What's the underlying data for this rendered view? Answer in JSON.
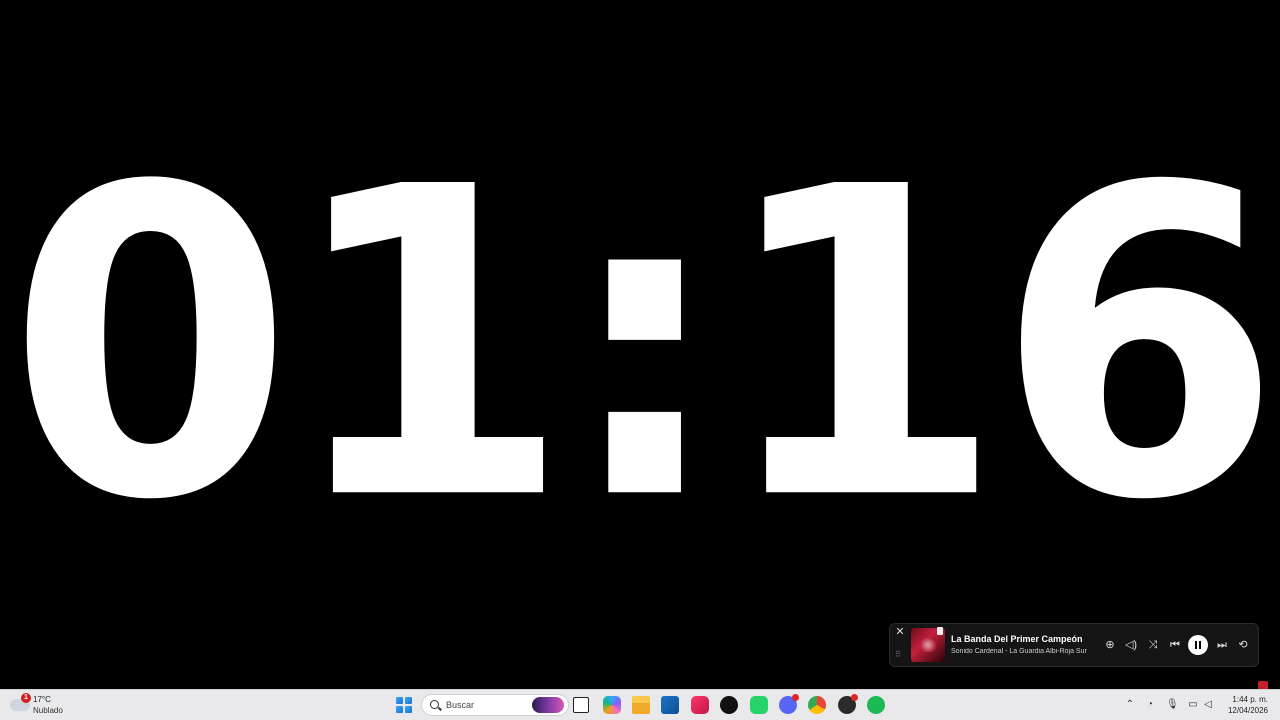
{
  "timer": {
    "display": "01:16"
  },
  "media": {
    "title": "La Banda Del Primer Campeón",
    "artist": "Sonido Cardenal - La Guardia Albi-Roja Sur"
  },
  "taskbar": {
    "weather": {
      "alert_count": "1",
      "temperature": "17°C",
      "condition": "Nublado"
    },
    "search": {
      "placeholder": "Buscar"
    },
    "pinned_icons": [
      "task-view-icon",
      "copilot-icon",
      "file-explorer-icon",
      "microsoft-store-icon",
      "app-icon",
      "tiktok-icon",
      "whatsapp-icon",
      "discord-icon",
      "chrome-icon",
      "obs-icon",
      "spotify-icon"
    ],
    "clock": {
      "time": "1:44 p. m.",
      "date": "12/04/2026"
    }
  },
  "colors": {
    "background": "#000000",
    "timer_text": "#ffffff",
    "taskbar": "#e9e9ec",
    "spotify": "#1db954",
    "whatsapp": "#25d366",
    "discord": "#5865f2"
  }
}
